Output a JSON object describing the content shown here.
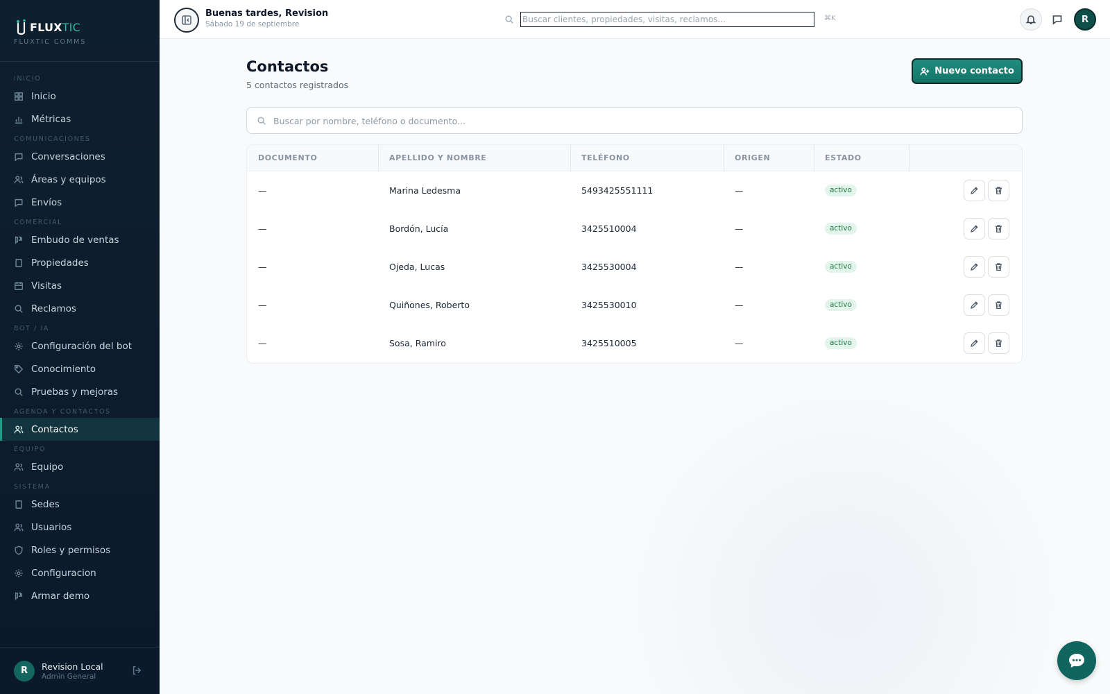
{
  "brand": {
    "name_part1": "FLUX",
    "name_part2": "TIC",
    "subtitle": "FLUXTIC COMMS"
  },
  "sidebar": {
    "sections": [
      {
        "title": "INICIO",
        "items": [
          {
            "label": "Inicio",
            "icon": "grid-icon"
          },
          {
            "label": "Métricas",
            "icon": "bar-chart-icon"
          }
        ]
      },
      {
        "title": "COMUNICACIONES",
        "items": [
          {
            "label": "Conversaciones",
            "icon": "message-icon"
          },
          {
            "label": "Áreas y equipos",
            "icon": "users-icon"
          },
          {
            "label": "Envíos",
            "icon": "message-icon"
          }
        ]
      },
      {
        "title": "COMERCIAL",
        "items": [
          {
            "label": "Embudo de ventas",
            "icon": "kanban-icon"
          },
          {
            "label": "Propiedades",
            "icon": "building-icon"
          },
          {
            "label": "Visitas",
            "icon": "calendar-icon"
          },
          {
            "label": "Reclamos",
            "icon": "search-icon"
          }
        ]
      },
      {
        "title": "BOT / IA",
        "items": [
          {
            "label": "Configuración del bot",
            "icon": "gear-icon"
          },
          {
            "label": "Conocimiento",
            "icon": "tag-icon"
          },
          {
            "label": "Pruebas y mejoras",
            "icon": "search-icon"
          }
        ]
      },
      {
        "title": "AGENDA Y CONTACTOS",
        "items": [
          {
            "label": "Contactos",
            "icon": "users-icon",
            "active": true
          }
        ]
      },
      {
        "title": "EQUIPO",
        "items": [
          {
            "label": "Equipo",
            "icon": "users-icon"
          }
        ]
      },
      {
        "title": "SISTEMA",
        "items": [
          {
            "label": "Sedes",
            "icon": "building-icon"
          },
          {
            "label": "Usuarios",
            "icon": "users-icon"
          },
          {
            "label": "Roles y permisos",
            "icon": "shield-icon"
          },
          {
            "label": "Configuracion",
            "icon": "gear-icon"
          },
          {
            "label": "Armar demo",
            "icon": "kanban-icon"
          }
        ]
      }
    ],
    "user": {
      "initial": "R",
      "name": "Revision Local",
      "role": "Admin General"
    }
  },
  "topbar": {
    "greeting": "Buenas tardes, Revision",
    "date": "Sábado 19 de septiembre",
    "search_placeholder": "Buscar clientes, propiedades, visitas, reclamos...",
    "shortcut": "⌘K",
    "avatar_initial": "R"
  },
  "page": {
    "title": "Contactos",
    "subtitle": "5 contactos registrados",
    "new_button": "Nuevo contacto",
    "search_placeholder": "Buscar por nombre, teléfono o documento..."
  },
  "table": {
    "columns": [
      "DOCUMENTO",
      "APELLIDO Y NOMBRE",
      "TELÉFONO",
      "ORIGEN",
      "ESTADO"
    ],
    "rows": [
      {
        "documento": "—",
        "nombre": "Marina Ledesma",
        "telefono": "5493425551111",
        "origen": "—",
        "estado": "activo"
      },
      {
        "documento": "—",
        "nombre": "Bordón, Lucía",
        "telefono": "3425510004",
        "origen": "—",
        "estado": "activo"
      },
      {
        "documento": "—",
        "nombre": "Ojeda, Lucas",
        "telefono": "3425530004",
        "origen": "—",
        "estado": "activo"
      },
      {
        "documento": "—",
        "nombre": "Quiñones, Roberto",
        "telefono": "3425530010",
        "origen": "—",
        "estado": "activo"
      },
      {
        "documento": "—",
        "nombre": "Sosa, Ramiro",
        "telefono": "3425510005",
        "origen": "—",
        "estado": "activo"
      }
    ]
  },
  "colors": {
    "accent": "#137466",
    "sidebar_bg": "#0e1f2e",
    "badge_bg": "#e3f5ea",
    "badge_text": "#1f7a45"
  }
}
